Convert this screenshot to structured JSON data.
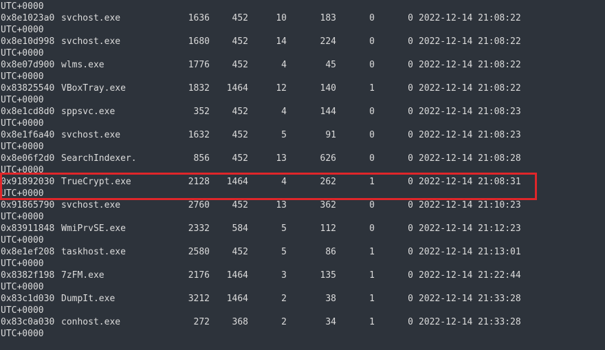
{
  "top_tz": "UTC+0000",
  "rows": [
    {
      "offset": "0x8e1023a0",
      "name": "svchost.exe",
      "pid": "1636",
      "ppid": "452",
      "threads": "10",
      "handles": "183",
      "session": "0",
      "wow64": "0",
      "create_time": "2022-12-14 21:08:22",
      "tz": "UTC+0000"
    },
    {
      "offset": "0x8e10d998",
      "name": "svchost.exe",
      "pid": "1680",
      "ppid": "452",
      "threads": "14",
      "handles": "224",
      "session": "0",
      "wow64": "0",
      "create_time": "2022-12-14 21:08:22",
      "tz": "UTC+0000"
    },
    {
      "offset": "0x8e07d900",
      "name": "wlms.exe",
      "pid": "1776",
      "ppid": "452",
      "threads": "4",
      "handles": "45",
      "session": "0",
      "wow64": "0",
      "create_time": "2022-12-14 21:08:22",
      "tz": "UTC+0000"
    },
    {
      "offset": "0x83825540",
      "name": "VBoxTray.exe",
      "pid": "1832",
      "ppid": "1464",
      "threads": "12",
      "handles": "140",
      "session": "1",
      "wow64": "0",
      "create_time": "2022-12-14 21:08:22",
      "tz": "UTC+0000"
    },
    {
      "offset": "0x8e1cd8d0",
      "name": "sppsvc.exe",
      "pid": "352",
      "ppid": "452",
      "threads": "4",
      "handles": "144",
      "session": "0",
      "wow64": "0",
      "create_time": "2022-12-14 21:08:23",
      "tz": "UTC+0000"
    },
    {
      "offset": "0x8e1f6a40",
      "name": "svchost.exe",
      "pid": "1632",
      "ppid": "452",
      "threads": "5",
      "handles": "91",
      "session": "0",
      "wow64": "0",
      "create_time": "2022-12-14 21:08:23",
      "tz": "UTC+0000"
    },
    {
      "offset": "0x8e06f2d0",
      "name": "SearchIndexer.",
      "pid": "856",
      "ppid": "452",
      "threads": "13",
      "handles": "626",
      "session": "0",
      "wow64": "0",
      "create_time": "2022-12-14 21:08:28",
      "tz": "UTC+0000"
    },
    {
      "offset": "0x91892030",
      "name": "TrueCrypt.exe",
      "pid": "2128",
      "ppid": "1464",
      "threads": "4",
      "handles": "262",
      "session": "1",
      "wow64": "0",
      "create_time": "2022-12-14 21:08:31",
      "tz": "UTC+0000"
    },
    {
      "offset": "0x91865790",
      "name": "svchost.exe",
      "pid": "2760",
      "ppid": "452",
      "threads": "13",
      "handles": "362",
      "session": "0",
      "wow64": "0",
      "create_time": "2022-12-14 21:10:23",
      "tz": "UTC+0000"
    },
    {
      "offset": "0x83911848",
      "name": "WmiPrvSE.exe",
      "pid": "2332",
      "ppid": "584",
      "threads": "5",
      "handles": "112",
      "session": "0",
      "wow64": "0",
      "create_time": "2022-12-14 21:12:23",
      "tz": "UTC+0000"
    },
    {
      "offset": "0x8e1ef208",
      "name": "taskhost.exe",
      "pid": "2580",
      "ppid": "452",
      "threads": "5",
      "handles": "86",
      "session": "1",
      "wow64": "0",
      "create_time": "2022-12-14 21:13:01",
      "tz": "UTC+0000"
    },
    {
      "offset": "0x8382f198",
      "name": "7zFM.exe",
      "pid": "2176",
      "ppid": "1464",
      "threads": "3",
      "handles": "135",
      "session": "1",
      "wow64": "0",
      "create_time": "2022-12-14 21:22:44",
      "tz": "UTC+0000"
    },
    {
      "offset": "0x83c1d030",
      "name": "DumpIt.exe",
      "pid": "3212",
      "ppid": "1464",
      "threads": "2",
      "handles": "38",
      "session": "1",
      "wow64": "0",
      "create_time": "2022-12-14 21:33:28",
      "tz": "UTC+0000"
    },
    {
      "offset": "0x83c0a030",
      "name": "conhost.exe",
      "pid": "272",
      "ppid": "368",
      "threads": "2",
      "handles": "34",
      "session": "1",
      "wow64": "0",
      "create_time": "2022-12-14 21:33:28",
      "tz": "UTC+0000"
    }
  ],
  "highlight": {
    "row_index": 7,
    "color": "#e0262a"
  },
  "colors": {
    "background": "#2d333b",
    "text": "#dcdcdc"
  }
}
